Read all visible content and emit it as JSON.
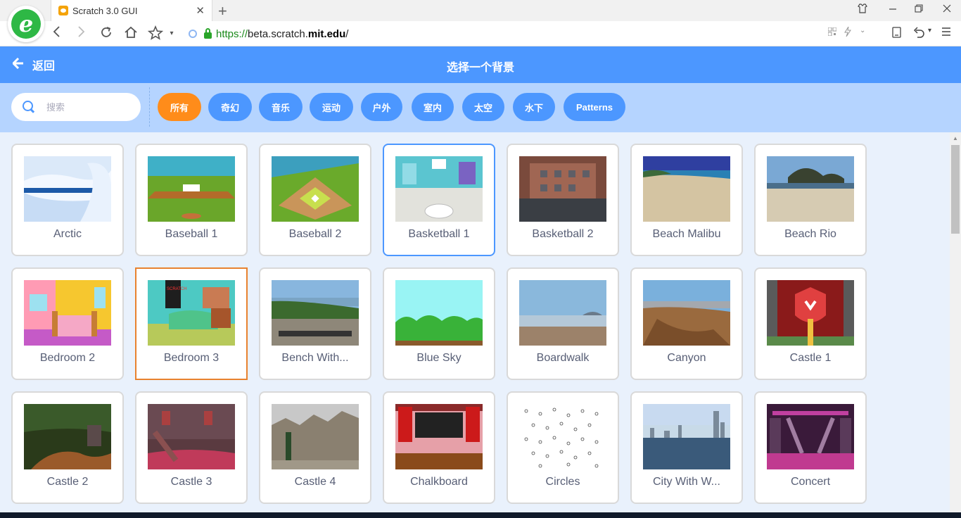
{
  "browser": {
    "tab_title": "Scratch 3.0 GUI",
    "tab_close": "✕",
    "new_tab": "+",
    "url_scheme": "https://",
    "url_host_pre": "beta.scratch.",
    "url_host_bold": "mit.edu",
    "url_path": "/",
    "icons": [
      "back-icon",
      "forward-icon",
      "reload-icon",
      "home-icon",
      "star-icon"
    ]
  },
  "header": {
    "back_label": "返回",
    "title": "选择一个背景"
  },
  "search": {
    "placeholder": "搜索"
  },
  "tags": [
    {
      "label": "所有"
    },
    {
      "label": "奇幻"
    },
    {
      "label": "音乐"
    },
    {
      "label": "运动"
    },
    {
      "label": "户外"
    },
    {
      "label": "室内"
    },
    {
      "label": "太空"
    },
    {
      "label": "水下"
    },
    {
      "label": "Patterns"
    }
  ],
  "active_tag": "所有",
  "colors": {
    "header": "#4c97ff",
    "filter_bar": "#b5d4ff",
    "active_tag": "#ff8c1a",
    "selected_border": "#4c97ff",
    "hover_border": "#e8822f"
  },
  "backdrops": [
    {
      "name": "Arctic"
    },
    {
      "name": "Baseball 1"
    },
    {
      "name": "Baseball 2"
    },
    {
      "name": "Basketball 1"
    },
    {
      "name": "Basketball 2"
    },
    {
      "name": "Beach Malibu"
    },
    {
      "name": "Beach Rio"
    },
    {
      "name": "Bedroom 2"
    },
    {
      "name": "Bedroom 3"
    },
    {
      "name": "Bench With..."
    },
    {
      "name": "Blue Sky"
    },
    {
      "name": "Boardwalk"
    },
    {
      "name": "Canyon"
    },
    {
      "name": "Castle 1"
    },
    {
      "name": "Castle 2"
    },
    {
      "name": "Castle 3"
    },
    {
      "name": "Castle 4"
    },
    {
      "name": "Chalkboard"
    },
    {
      "name": "Circles"
    },
    {
      "name": "City With W..."
    },
    {
      "name": "Concert"
    }
  ]
}
